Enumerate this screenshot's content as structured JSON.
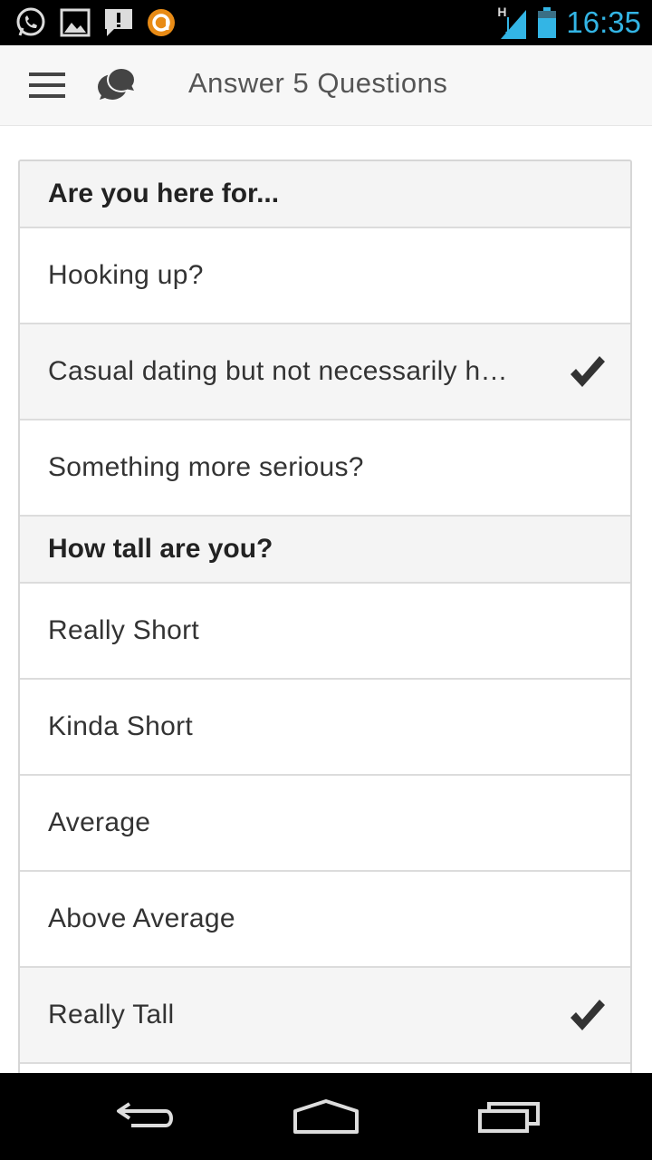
{
  "status_bar": {
    "time": "16:35",
    "network_label": "H",
    "icons": [
      "whatsapp-icon",
      "image-icon",
      "alert-message-icon",
      "avast-icon",
      "signal-icon",
      "battery-icon"
    ]
  },
  "action_bar": {
    "title": "Answer 5 Questions",
    "menu_icon": "hamburger-menu-icon",
    "logo_icon": "chat-bubbles-icon"
  },
  "questions": [
    {
      "header": "Are you here for...",
      "options": [
        {
          "label": "Hooking up?",
          "selected": false
        },
        {
          "label": "Casual dating but not necessarily h…",
          "selected": true
        },
        {
          "label": "Something more serious?",
          "selected": false
        }
      ]
    },
    {
      "header": "How tall are you?",
      "options": [
        {
          "label": "Really Short",
          "selected": false
        },
        {
          "label": "Kinda Short",
          "selected": false
        },
        {
          "label": "Average",
          "selected": false
        },
        {
          "label": "Above Average",
          "selected": false
        },
        {
          "label": "Really Tall",
          "selected": true
        }
      ]
    }
  ],
  "nav_bar": {
    "icons": [
      "back-icon",
      "home-icon",
      "recent-apps-icon"
    ]
  },
  "colors": {
    "accent": "#33b5e5",
    "selected_row": "#f5f5f5",
    "header_row": "#f4f4f4",
    "check": "#333333"
  }
}
